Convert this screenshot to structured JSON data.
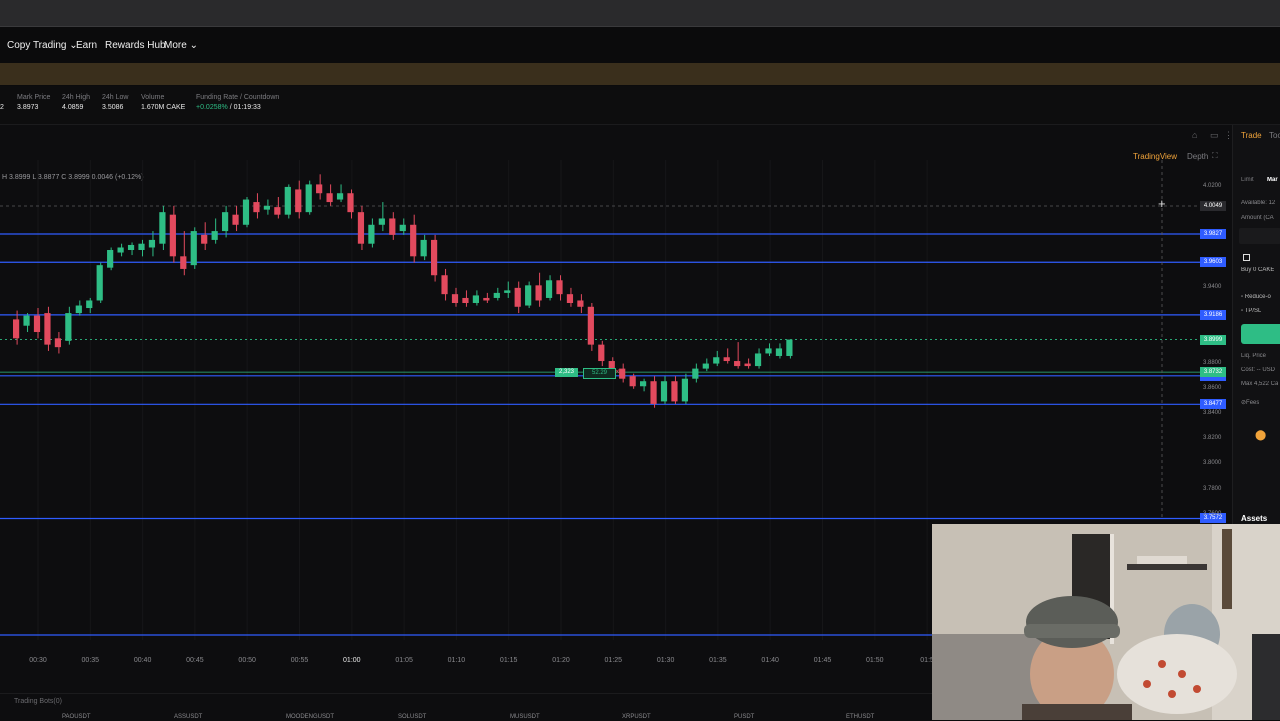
{
  "nav": {
    "copy_trading": "Copy Trading",
    "earn": "Earn",
    "rewards_hub": "Rewards Hub",
    "more": "More"
  },
  "ticker": {
    "prefix": "2",
    "mark_price_label": "Mark Price",
    "mark_price": "3.8973",
    "high_label": "24h High",
    "high": "4.0859",
    "low_label": "24h Low",
    "low": "3.5086",
    "volume_label": "Volume",
    "volume": "1.670M CAKE",
    "funding_label": "Funding Rate / Countdown",
    "funding_rate": "+0.0258%",
    "countdown": "/ 01:19:33"
  },
  "chart_header": {
    "ohlc_text": "H 3.8999  L 3.8877  C 3.8999  0.0046 (+0.12%)",
    "tradingview": "TradingView",
    "depth": "Depth"
  },
  "chart_data": {
    "type": "candlestick",
    "symbol": "CAKE",
    "x_ticks": [
      "00:30",
      "00:35",
      "00:40",
      "00:45",
      "00:50",
      "00:55",
      "01:00",
      "01:05",
      "01:10",
      "01:15",
      "01:20",
      "01:25",
      "01:30",
      "01:35",
      "01:40",
      "01:45",
      "01:50",
      "01:5"
    ],
    "y_ticks": [
      "4.0200",
      "3.9400",
      "3.8800",
      "3.8600",
      "3.8400",
      "3.8200",
      "3.8000",
      "3.7800",
      "3.7600"
    ],
    "ylim": [
      3.756,
      4.035
    ],
    "horizontal_levels": [
      {
        "price": 3.9827,
        "label": "3.9827",
        "color": "#2f5cff"
      },
      {
        "price": 3.9603,
        "label": "3.9603",
        "color": "#2f5cff"
      },
      {
        "price": 3.9186,
        "label": "3.9186",
        "color": "#2f5cff"
      },
      {
        "price": 3.8703,
        "label": "3.8703",
        "color": "#2f5cff"
      },
      {
        "price": 3.8477,
        "label": "3.8477",
        "color": "#2f5cff"
      },
      {
        "price": 3.7572,
        "label": "3.7572",
        "color": "#2f5cff"
      }
    ],
    "current_price": {
      "label": "3.8999",
      "color": "#2ebd85"
    },
    "position_price": {
      "label": "3.8732",
      "color": "#2ebd85"
    },
    "crosshair_price": {
      "price": 4.0049,
      "label": "4.0049"
    },
    "position_tag": {
      "size": "2,323",
      "pnl": "52.29"
    },
    "candles": [
      {
        "t": "00:28",
        "o": 3.915,
        "h": 3.922,
        "c": 3.9,
        "l": 3.895
      },
      {
        "t": "00:29",
        "o": 3.91,
        "h": 3.92,
        "c": 3.918,
        "l": 3.905
      },
      {
        "t": "00:30",
        "o": 3.918,
        "h": 3.924,
        "c": 3.905,
        "l": 3.9
      },
      {
        "t": "00:31",
        "o": 3.92,
        "h": 3.925,
        "c": 3.895,
        "l": 3.89
      },
      {
        "t": "00:32",
        "o": 3.9,
        "h": 3.905,
        "c": 3.893,
        "l": 3.888
      },
      {
        "t": "00:33",
        "o": 3.898,
        "h": 3.925,
        "c": 3.92,
        "l": 3.895
      },
      {
        "t": "00:34",
        "o": 3.92,
        "h": 3.93,
        "c": 3.926,
        "l": 3.918
      },
      {
        "t": "00:35",
        "o": 3.924,
        "h": 3.932,
        "c": 3.93,
        "l": 3.92
      },
      {
        "t": "00:36",
        "o": 3.93,
        "h": 3.96,
        "c": 3.958,
        "l": 3.928
      },
      {
        "t": "00:37",
        "o": 3.956,
        "h": 3.972,
        "c": 3.97,
        "l": 3.954
      },
      {
        "t": "00:38",
        "o": 3.968,
        "h": 3.975,
        "c": 3.972,
        "l": 3.965
      },
      {
        "t": "00:39",
        "o": 3.97,
        "h": 3.976,
        "c": 3.974,
        "l": 3.966
      },
      {
        "t": "00:40",
        "o": 3.97,
        "h": 3.978,
        "c": 3.975,
        "l": 3.965
      },
      {
        "t": "00:41",
        "o": 3.972,
        "h": 3.985,
        "c": 3.978,
        "l": 3.965
      },
      {
        "t": "00:42",
        "o": 3.975,
        "h": 4.005,
        "c": 4.0,
        "l": 3.97
      },
      {
        "t": "00:43",
        "o": 3.998,
        "h": 4.005,
        "c": 3.965,
        "l": 3.96
      },
      {
        "t": "00:44",
        "o": 3.965,
        "h": 3.985,
        "c": 3.955,
        "l": 3.95
      },
      {
        "t": "00:45",
        "o": 3.958,
        "h": 3.988,
        "c": 3.985,
        "l": 3.955
      },
      {
        "t": "00:46",
        "o": 3.982,
        "h": 3.992,
        "c": 3.975,
        "l": 3.97
      },
      {
        "t": "00:47",
        "o": 3.978,
        "h": 3.995,
        "c": 3.985,
        "l": 3.975
      },
      {
        "t": "00:48",
        "o": 3.985,
        "h": 4.005,
        "c": 4.0,
        "l": 3.98
      },
      {
        "t": "00:49",
        "o": 3.998,
        "h": 4.005,
        "c": 3.99,
        "l": 3.985
      },
      {
        "t": "00:50",
        "o": 3.99,
        "h": 4.012,
        "c": 4.01,
        "l": 3.988
      },
      {
        "t": "00:51",
        "o": 4.008,
        "h": 4.015,
        "c": 4.0,
        "l": 3.995
      },
      {
        "t": "00:52",
        "o": 4.002,
        "h": 4.01,
        "c": 4.005,
        "l": 3.998
      },
      {
        "t": "00:53",
        "o": 4.004,
        "h": 4.012,
        "c": 3.998,
        "l": 3.995
      },
      {
        "t": "00:54",
        "o": 3.998,
        "h": 4.022,
        "c": 4.02,
        "l": 3.995
      },
      {
        "t": "00:55",
        "o": 4.018,
        "h": 4.025,
        "c": 4.0,
        "l": 3.995
      },
      {
        "t": "00:56",
        "o": 4.0,
        "h": 4.025,
        "c": 4.022,
        "l": 3.998
      },
      {
        "t": "00:57",
        "o": 4.022,
        "h": 4.03,
        "c": 4.015,
        "l": 4.01
      },
      {
        "t": "00:58",
        "o": 4.015,
        "h": 4.022,
        "c": 4.008,
        "l": 4.005
      },
      {
        "t": "00:59",
        "o": 4.01,
        "h": 4.022,
        "c": 4.015,
        "l": 4.008
      },
      {
        "t": "01:00",
        "o": 4.015,
        "h": 4.018,
        "c": 4.0,
        "l": 3.995
      },
      {
        "t": "01:01",
        "o": 4.0,
        "h": 4.005,
        "c": 3.975,
        "l": 3.97
      },
      {
        "t": "01:02",
        "o": 3.975,
        "h": 3.995,
        "c": 3.99,
        "l": 3.972
      },
      {
        "t": "01:03",
        "o": 3.99,
        "h": 4.008,
        "c": 3.995,
        "l": 3.985
      },
      {
        "t": "01:04",
        "o": 3.995,
        "h": 4.0,
        "c": 3.982,
        "l": 3.978
      },
      {
        "t": "01:05",
        "o": 3.985,
        "h": 3.995,
        "c": 3.99,
        "l": 3.982
      },
      {
        "t": "01:06",
        "o": 3.99,
        "h": 3.998,
        "c": 3.965,
        "l": 3.96
      },
      {
        "t": "01:07",
        "o": 3.965,
        "h": 3.982,
        "c": 3.978,
        "l": 3.962
      },
      {
        "t": "01:08",
        "o": 3.978,
        "h": 3.982,
        "c": 3.95,
        "l": 3.945
      },
      {
        "t": "01:09",
        "o": 3.95,
        "h": 3.955,
        "c": 3.935,
        "l": 3.93
      },
      {
        "t": "01:10",
        "o": 3.935,
        "h": 3.94,
        "c": 3.928,
        "l": 3.925
      },
      {
        "t": "01:11",
        "o": 3.932,
        "h": 3.938,
        "c": 3.928,
        "l": 3.925
      },
      {
        "t": "01:12",
        "o": 3.928,
        "h": 3.938,
        "c": 3.934,
        "l": 3.926
      },
      {
        "t": "01:13",
        "o": 3.932,
        "h": 3.936,
        "c": 3.93,
        "l": 3.928
      },
      {
        "t": "01:14",
        "o": 3.932,
        "h": 3.94,
        "c": 3.936,
        "l": 3.93
      },
      {
        "t": "01:15",
        "o": 3.936,
        "h": 3.945,
        "c": 3.938,
        "l": 3.932
      },
      {
        "t": "01:16",
        "o": 3.94,
        "h": 3.945,
        "c": 3.925,
        "l": 3.92
      },
      {
        "t": "01:17",
        "o": 3.926,
        "h": 3.945,
        "c": 3.942,
        "l": 3.924
      },
      {
        "t": "01:18",
        "o": 3.942,
        "h": 3.952,
        "c": 3.93,
        "l": 3.925
      },
      {
        "t": "01:19",
        "o": 3.932,
        "h": 3.95,
        "c": 3.946,
        "l": 3.93
      },
      {
        "t": "01:20",
        "o": 3.946,
        "h": 3.95,
        "c": 3.935,
        "l": 3.93
      },
      {
        "t": "01:21",
        "o": 3.935,
        "h": 3.94,
        "c": 3.928,
        "l": 3.925
      },
      {
        "t": "01:22",
        "o": 3.93,
        "h": 3.935,
        "c": 3.925,
        "l": 3.92
      },
      {
        "t": "01:23",
        "o": 3.925,
        "h": 3.928,
        "c": 3.895,
        "l": 3.89
      },
      {
        "t": "01:24",
        "o": 3.895,
        "h": 3.898,
        "c": 3.882,
        "l": 3.878
      },
      {
        "t": "01:25",
        "o": 3.882,
        "h": 3.885,
        "c": 3.875,
        "l": 3.872
      },
      {
        "t": "01:26",
        "o": 3.876,
        "h": 3.88,
        "c": 3.868,
        "l": 3.865
      },
      {
        "t": "01:27",
        "o": 3.87,
        "h": 3.872,
        "c": 3.862,
        "l": 3.86
      },
      {
        "t": "01:28",
        "o": 3.862,
        "h": 3.868,
        "c": 3.866,
        "l": 3.858
      },
      {
        "t": "01:29",
        "o": 3.866,
        "h": 3.87,
        "c": 3.848,
        "l": 3.845
      },
      {
        "t": "01:30",
        "o": 3.85,
        "h": 3.87,
        "c": 3.866,
        "l": 3.848
      },
      {
        "t": "01:31",
        "o": 3.866,
        "h": 3.87,
        "c": 3.85,
        "l": 3.848
      },
      {
        "t": "01:32",
        "o": 3.85,
        "h": 3.872,
        "c": 3.868,
        "l": 3.848
      },
      {
        "t": "01:33",
        "o": 3.868,
        "h": 3.88,
        "c": 3.876,
        "l": 3.865
      },
      {
        "t": "01:34",
        "o": 3.876,
        "h": 3.884,
        "c": 3.88,
        "l": 3.874
      },
      {
        "t": "01:35",
        "o": 3.88,
        "h": 3.89,
        "c": 3.885,
        "l": 3.878
      },
      {
        "t": "01:36",
        "o": 3.885,
        "h": 3.892,
        "c": 3.882,
        "l": 3.88
      },
      {
        "t": "01:37",
        "o": 3.882,
        "h": 3.897,
        "c": 3.878,
        "l": 3.876
      },
      {
        "t": "01:38",
        "o": 3.88,
        "h": 3.884,
        "c": 3.878,
        "l": 3.876
      },
      {
        "t": "01:39",
        "o": 3.878,
        "h": 3.892,
        "c": 3.888,
        "l": 3.876
      },
      {
        "t": "01:40",
        "o": 3.888,
        "h": 3.896,
        "c": 3.892,
        "l": 3.886
      },
      {
        "t": "01:41",
        "o": 3.886,
        "h": 3.896,
        "c": 3.892,
        "l": 3.884
      },
      {
        "t": "01:42",
        "o": 3.886,
        "h": 3.899,
        "c": 3.899,
        "l": 3.884
      }
    ]
  },
  "right_panel": {
    "tab_trade": "Trade",
    "tab_tools": "Too",
    "order_limit": "Limit",
    "order_market": "Mar",
    "available": "Available: 12",
    "amount": "Amount (CA",
    "buy": "Buy 0 CAKE",
    "reduce": "Reduce-o",
    "tpsl": "TP/SL",
    "liq_price": "Liq. Price",
    "cost": "Cost: -- USD",
    "max": "Max 4,522 Ca",
    "fees": "Fees",
    "assets": "Assets"
  },
  "bottom": {
    "trading_bots": "Trading Bots(0)",
    "tickers": [
      "PAOUSDT",
      "ASSUSDT",
      "MOODENGUSDT",
      "SOLUSDT",
      "MUSUSDT",
      "XRPUSDT",
      "PUSDT",
      "ETHUSDT"
    ]
  },
  "webcam": {
    "label": "webcam-overlay"
  }
}
